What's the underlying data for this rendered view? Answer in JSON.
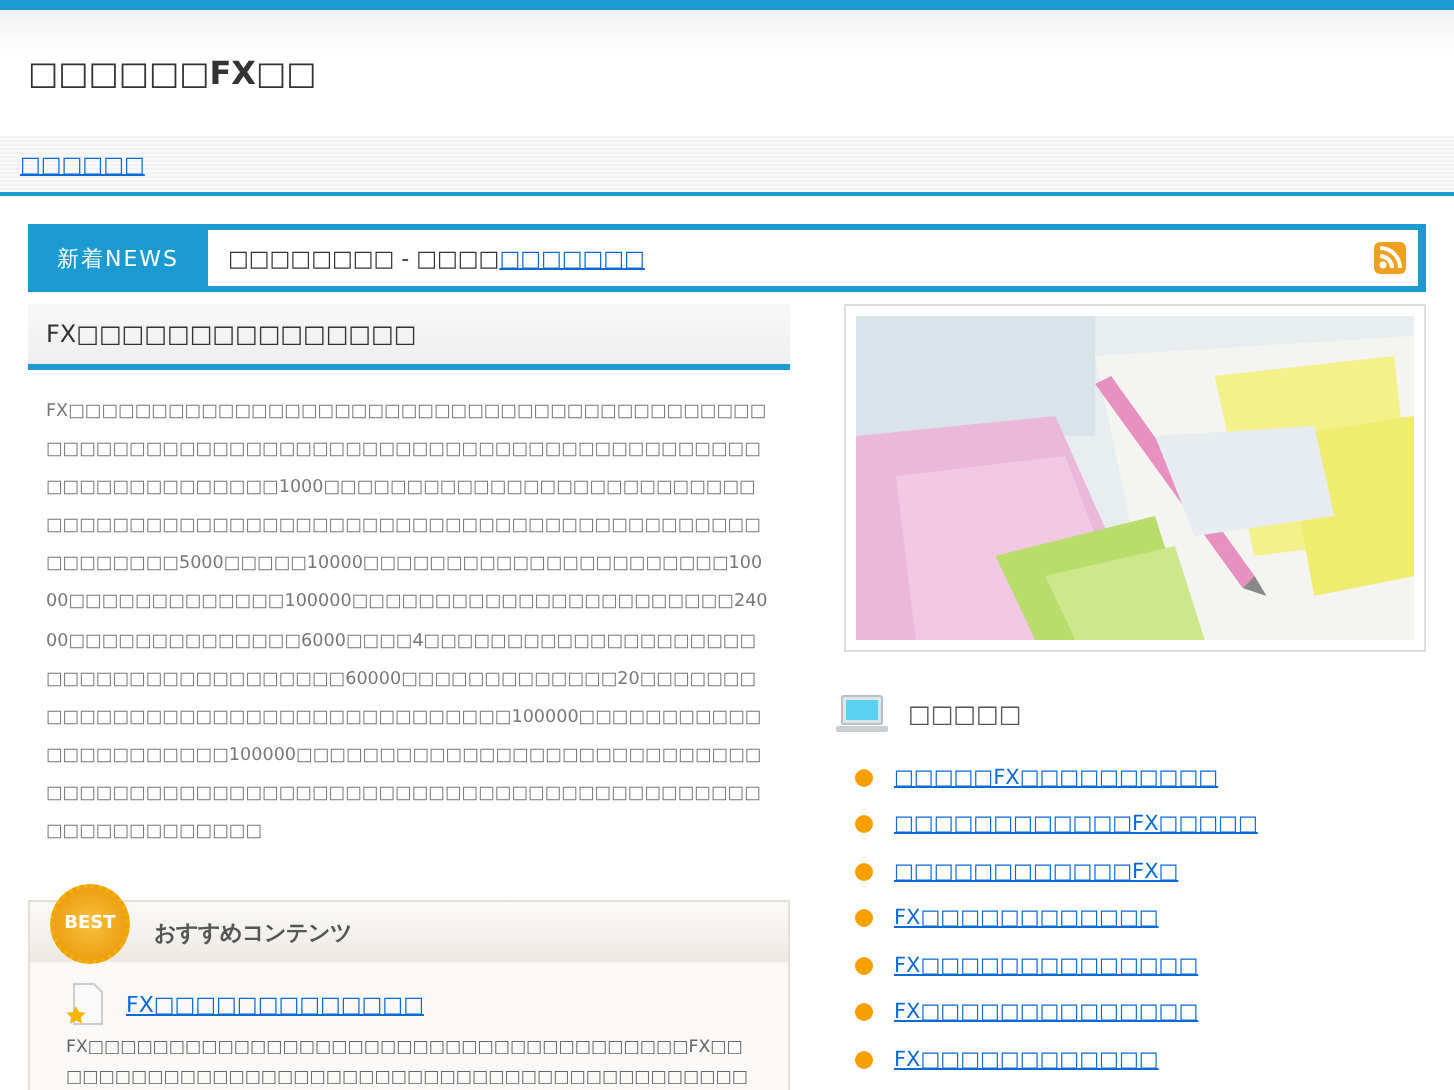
{
  "site_title": "□□□□□□FX□□",
  "nav": [
    {
      "label": "□□□□□□"
    }
  ],
  "news": {
    "label": "新着NEWS",
    "text": "□□□□□□□□ - □□□□",
    "link": "□□□□□□□"
  },
  "article": {
    "heading": "FX□□□□□□□□□□□□□□□",
    "body": "FX□□□□□□□□□□□□□□□□□□□□□□□□□□□□□□□□□□□□□□□□□□□□□□□□□□□□□□□□□□□□□□□□□□□□□□□□□□□□□□□□□□□□□□□□□□□□□□□□□□□1000□□□□□□□□□□□□□□□□□□□□□□□□□□□□□□□□□□□□□□□□□□□□□□□□□□□□□□□□□□□□□□□□□□□□□□□□□□□□□5000□□□□□10000□□□□□□□□□□□□□□□□□□□□□□10000□□□□□□□□□□□□□100000□□□□□□□□□□□□□□□□□□□□□□□24000□□□□□□□□□□□□□□6000□□□□4□□□□□□□□□□□□□□□□□□□□□□□□□□□□□□□□□□□□□□60000□□□□□□□□□□□□□20□□□□□□□□□□□□□□□□□□□□□□□□□□□□□□□□□□□100000□□□□□□□□□□□□□□□□□□□□□□100000□□□□□□□□□□□□□□□□□□□□□□□□□□□□□□□□□□□□□□□□□□□□□□□□□□□□□□□□□□□□□□□□□□□□□□□□□□□□□□□□□□□□"
  },
  "recommend": {
    "badge": "BEST",
    "heading": "おすすめコンテンツ",
    "items": [
      {
        "title": "FX□□□□□□□□□□□□□",
        "text": "FX□□□□□□□□□□□□□□□□□□□□□□□□□□□□□□□□□□□□□FX□□□□□□□□□□□□□□□□□□□□□□□□□□□□□□□□□□□□□□□□□□□□□□□…"
      }
    ]
  },
  "sidebar": {
    "heading": "□□□□□",
    "links": [
      {
        "label": "□□□□□FX□□□□□□□□□□"
      },
      {
        "label": "□□□□□□□□□□□□FX□□□□□"
      },
      {
        "label": "□□□□□□□□□□□□FX□"
      },
      {
        "label": "FX□□□□□□□□□□□□"
      },
      {
        "label": "FX□□□□□□□□□□□□□□"
      },
      {
        "label": "FX□□□□□□□□□□□□□□"
      },
      {
        "label": "FX□□□□□□□□□□□□"
      }
    ]
  }
}
